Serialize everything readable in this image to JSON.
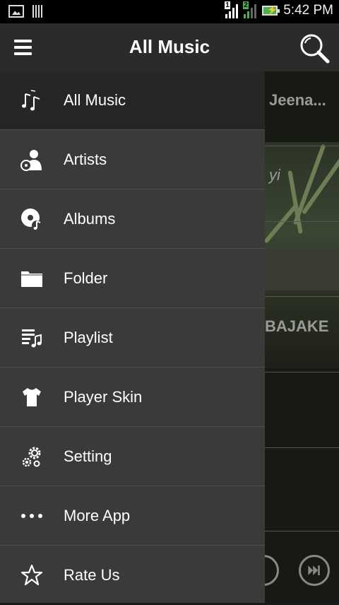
{
  "status_bar": {
    "time": "5:42 PM",
    "sim1_label": "1",
    "sim2_label": "2"
  },
  "header": {
    "title": "All Music"
  },
  "background": {
    "row1_text": "Jeena...",
    "row2_text": "yi",
    "row3_text": "BAJAKE"
  },
  "drawer": {
    "items": [
      {
        "label": "All Music",
        "icon": "music-note-icon",
        "active": true
      },
      {
        "label": "Artists",
        "icon": "artist-icon"
      },
      {
        "label": "Albums",
        "icon": "album-icon"
      },
      {
        "label": "Folder",
        "icon": "folder-icon"
      },
      {
        "label": "Playlist",
        "icon": "playlist-icon"
      },
      {
        "label": "Player Skin",
        "icon": "tshirt-icon"
      },
      {
        "label": "Setting",
        "icon": "gears-icon"
      },
      {
        "label": "More App",
        "icon": "more-dots-icon"
      },
      {
        "label": "Rate Us",
        "icon": "star-icon"
      }
    ]
  },
  "colors": {
    "drawer_bg": "#3a3a39",
    "active_item_bg": "#262626",
    "header_bg": "#2b2b2a",
    "battery_green": "#4caf50"
  }
}
